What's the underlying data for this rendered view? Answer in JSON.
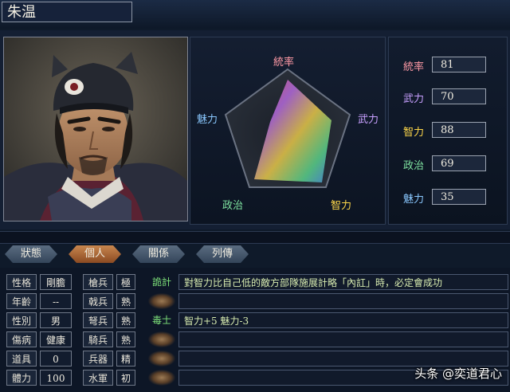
{
  "officer": {
    "name": "朱温"
  },
  "radar": {
    "labels": {
      "top": "統率",
      "right": "武力",
      "bottom_right": "智力",
      "bottom_left": "政治",
      "left": "魅力"
    }
  },
  "stats": [
    {
      "label": "統率",
      "value": "81",
      "color": "#ff9aa6"
    },
    {
      "label": "武力",
      "value": "70",
      "color": "#c8a0ff"
    },
    {
      "label": "智力",
      "value": "88",
      "color": "#ffd84a"
    },
    {
      "label": "政治",
      "value": "69",
      "color": "#7ee2a0"
    },
    {
      "label": "魅力",
      "value": "35",
      "color": "#8ac8ff"
    }
  ],
  "tabs": [
    {
      "label": "狀態",
      "active": false
    },
    {
      "label": "個人",
      "active": true
    },
    {
      "label": "關係",
      "active": false
    },
    {
      "label": "列傳",
      "active": false
    }
  ],
  "personal": [
    {
      "label": "性格",
      "value": "剛膽"
    },
    {
      "label": "年齡",
      "value": "--"
    },
    {
      "label": "性別",
      "value": "男"
    },
    {
      "label": "傷病",
      "value": "健康"
    },
    {
      "label": "道具",
      "value": "0"
    },
    {
      "label": "體力",
      "value": "100"
    }
  ],
  "troops": [
    {
      "label": "槍兵",
      "value": "極"
    },
    {
      "label": "戟兵",
      "value": "熟"
    },
    {
      "label": "弩兵",
      "value": "熟"
    },
    {
      "label": "騎兵",
      "value": "熟"
    },
    {
      "label": "兵器",
      "value": "精"
    },
    {
      "label": "水軍",
      "value": "初"
    }
  ],
  "skills": [
    {
      "name": "詭計",
      "text": "對智力比自己低的敵方部隊施展計略「內訌」時，必定會成功"
    },
    {
      "name": "",
      "text": ""
    },
    {
      "name": "毒士",
      "text": "智力+5 魅力-3"
    },
    {
      "name": "",
      "text": ""
    },
    {
      "name": "",
      "text": ""
    },
    {
      "name": "",
      "text": ""
    }
  ],
  "colors": {
    "skill_name": "#7ee27a"
  },
  "watermark": "头条 @奕道君心"
}
